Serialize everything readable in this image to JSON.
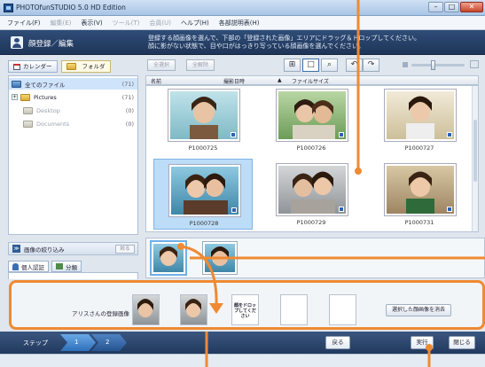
{
  "window": {
    "title": "PHOTOfunSTUDIO 5.0 HD Edition",
    "buttons": [
      "–",
      "□",
      "✕"
    ]
  },
  "menu": [
    "ファイル(F)",
    "編集(E)",
    "表示(V)",
    "ツール(T)",
    "会員(U)",
    "ヘルプ(H)",
    "各部説明表(H)"
  ],
  "header": {
    "title": "顔登録／編集",
    "description_line1": "登録する顔画像を選んで、下部の「登録された画像」エリアにドラッグ＆ドロップしてください。",
    "description_line2": "顔に影がない状態で、目や口がはっきり写っている顔画像を選んでください。"
  },
  "left": {
    "tabs": [
      {
        "label": "カレンダー"
      },
      {
        "label": "フォルダ"
      }
    ],
    "tree": [
      {
        "label": "全てのファイル",
        "count": "(71)"
      },
      {
        "label": "Pictures",
        "count": "(71)"
      },
      {
        "label": "Desktop",
        "count": "(0)"
      },
      {
        "label": "Documents",
        "count": "(0)"
      }
    ],
    "filter": {
      "label": "画像の絞り込み",
      "button": "絞る"
    },
    "person_tabs": [
      {
        "label": "個人認証"
      },
      {
        "label": "分類"
      }
    ]
  },
  "toolbar": {
    "select_all": "全選択",
    "deselect_all": "全解除"
  },
  "columns": {
    "name": "名前",
    "date": "撮影日時",
    "size": "ファイルサイズ"
  },
  "photos": [
    {
      "name": "P1000725",
      "selected": false
    },
    {
      "name": "P1000726",
      "selected": false
    },
    {
      "name": "P1000727",
      "selected": false
    },
    {
      "name": "P1000728",
      "selected": true
    },
    {
      "name": "P1000729",
      "selected": false
    },
    {
      "name": "P1000731",
      "selected": false
    }
  ],
  "registration": {
    "label": "アリスさんの登録画像",
    "drop_hint": "顔をドロップしてください",
    "clear_button": "選択した顔画像を消去"
  },
  "stepbar": {
    "label": "ステップ",
    "steps": [
      "1",
      "2"
    ],
    "back": "戻る",
    "execute": "実行",
    "close": "閉じる"
  },
  "colors": {
    "accent": "#ef8a32",
    "header": "#2f4d78",
    "selection": "#bcdcf7"
  }
}
